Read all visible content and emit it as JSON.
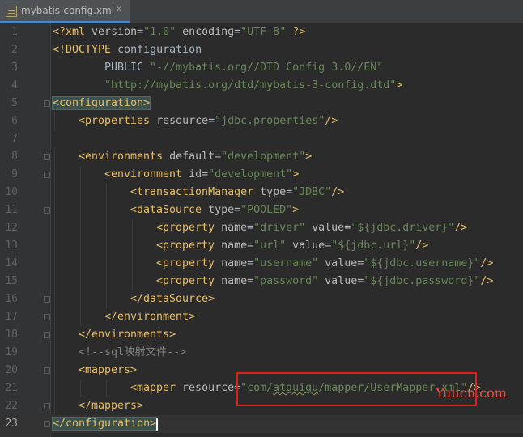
{
  "tab": {
    "filename": "mybatis-config.xml",
    "close_glyph": "✕",
    "icon": "xml-file-icon"
  },
  "lines": [
    {
      "n": "1",
      "indent": 0,
      "fold": false,
      "segs": [
        [
          "t-dec",
          "<?xml "
        ],
        [
          "t-attr",
          "version"
        ],
        [
          "t-txt",
          "="
        ],
        [
          "t-val",
          "\"1.0\""
        ],
        [
          "t-attr",
          " encoding"
        ],
        [
          "t-txt",
          "="
        ],
        [
          "t-val",
          "\"UTF-8\""
        ],
        [
          "t-dec",
          " ?>"
        ]
      ]
    },
    {
      "n": "2",
      "indent": 0,
      "fold": false,
      "segs": [
        [
          "t-tag",
          "<!DOCTYPE "
        ],
        [
          "t-txt",
          "configuration"
        ]
      ]
    },
    {
      "n": "3",
      "indent": 2,
      "fold": false,
      "segs": [
        [
          "t-txt",
          "PUBLIC "
        ],
        [
          "t-val",
          "\"-//mybatis.org//DTD Config 3.0//EN\""
        ]
      ]
    },
    {
      "n": "4",
      "indent": 2,
      "fold": false,
      "segs": [
        [
          "t-val",
          "\"http://mybatis.org/dtd/mybatis-3-config.dtd\""
        ],
        [
          "t-tag",
          ">"
        ]
      ]
    },
    {
      "n": "5",
      "indent": 0,
      "fold": true,
      "segs": [
        [
          "t-tag hl",
          "<configuration>"
        ]
      ]
    },
    {
      "n": "6",
      "indent": 1,
      "fold": false,
      "segs": [
        [
          "t-tag",
          "<properties "
        ],
        [
          "t-attr",
          "resource"
        ],
        [
          "t-txt",
          "="
        ],
        [
          "t-val",
          "\"jdbc.properties\""
        ],
        [
          "t-tag",
          "/>"
        ]
      ]
    },
    {
      "n": "7",
      "indent": 0,
      "fold": false,
      "segs": []
    },
    {
      "n": "8",
      "indent": 1,
      "fold": true,
      "segs": [
        [
          "t-tag",
          "<environments "
        ],
        [
          "t-attr",
          "default"
        ],
        [
          "t-txt",
          "="
        ],
        [
          "t-val",
          "\"development\""
        ],
        [
          "t-tag",
          ">"
        ]
      ]
    },
    {
      "n": "9",
      "indent": 2,
      "fold": true,
      "segs": [
        [
          "t-tag",
          "<environment "
        ],
        [
          "t-attr",
          "id"
        ],
        [
          "t-txt",
          "="
        ],
        [
          "t-val",
          "\"development\""
        ],
        [
          "t-tag",
          ">"
        ]
      ]
    },
    {
      "n": "10",
      "indent": 3,
      "fold": false,
      "segs": [
        [
          "t-tag",
          "<transactionManager "
        ],
        [
          "t-attr",
          "type"
        ],
        [
          "t-txt",
          "="
        ],
        [
          "t-val",
          "\"JDBC\""
        ],
        [
          "t-tag",
          "/>"
        ]
      ]
    },
    {
      "n": "11",
      "indent": 3,
      "fold": true,
      "segs": [
        [
          "t-tag",
          "<dataSource "
        ],
        [
          "t-attr",
          "type"
        ],
        [
          "t-txt",
          "="
        ],
        [
          "t-val",
          "\"POOLED\""
        ],
        [
          "t-tag",
          ">"
        ]
      ]
    },
    {
      "n": "12",
      "indent": 4,
      "fold": false,
      "segs": [
        [
          "t-tag",
          "<property "
        ],
        [
          "t-attr",
          "name"
        ],
        [
          "t-txt",
          "="
        ],
        [
          "t-val",
          "\"driver\""
        ],
        [
          "t-attr",
          " value"
        ],
        [
          "t-txt",
          "="
        ],
        [
          "t-val",
          "\"${jdbc.driver}\""
        ],
        [
          "t-tag",
          "/>"
        ]
      ]
    },
    {
      "n": "13",
      "indent": 4,
      "fold": false,
      "segs": [
        [
          "t-tag",
          "<property "
        ],
        [
          "t-attr",
          "name"
        ],
        [
          "t-txt",
          "="
        ],
        [
          "t-val",
          "\"url\""
        ],
        [
          "t-attr",
          " value"
        ],
        [
          "t-txt",
          "="
        ],
        [
          "t-val",
          "\"${jdbc.url}\""
        ],
        [
          "t-tag",
          "/>"
        ]
      ]
    },
    {
      "n": "14",
      "indent": 4,
      "fold": false,
      "segs": [
        [
          "t-tag",
          "<property "
        ],
        [
          "t-attr",
          "name"
        ],
        [
          "t-txt",
          "="
        ],
        [
          "t-val",
          "\"username\""
        ],
        [
          "t-attr",
          " value"
        ],
        [
          "t-txt",
          "="
        ],
        [
          "t-val",
          "\"${jdbc.username}\""
        ],
        [
          "t-tag",
          "/>"
        ]
      ]
    },
    {
      "n": "15",
      "indent": 4,
      "fold": false,
      "segs": [
        [
          "t-tag",
          "<property "
        ],
        [
          "t-attr",
          "name"
        ],
        [
          "t-txt",
          "="
        ],
        [
          "t-val",
          "\"password\""
        ],
        [
          "t-attr",
          " value"
        ],
        [
          "t-txt",
          "="
        ],
        [
          "t-val",
          "\"${jdbc.password}\""
        ],
        [
          "t-tag",
          "/>"
        ]
      ]
    },
    {
      "n": "16",
      "indent": 3,
      "fold": true,
      "segs": [
        [
          "t-tag",
          "</dataSource>"
        ]
      ]
    },
    {
      "n": "17",
      "indent": 2,
      "fold": true,
      "segs": [
        [
          "t-tag",
          "</environment>"
        ]
      ]
    },
    {
      "n": "18",
      "indent": 1,
      "fold": true,
      "segs": [
        [
          "t-tag",
          "</environments>"
        ]
      ]
    },
    {
      "n": "19",
      "indent": 1,
      "fold": false,
      "segs": [
        [
          "t-cmt",
          "<!--sql映射文件-->"
        ]
      ]
    },
    {
      "n": "20",
      "indent": 1,
      "fold": true,
      "segs": [
        [
          "t-tag",
          "<mappers>"
        ]
      ]
    },
    {
      "n": "21",
      "indent": 3,
      "fold": false,
      "segs": [
        [
          "t-tag",
          "<mapper "
        ],
        [
          "t-attr",
          "resource"
        ],
        [
          "t-txt",
          "="
        ],
        [
          "t-val",
          "\"com/"
        ],
        [
          "t-val squiggle",
          "atguigu"
        ],
        [
          "t-val",
          "/mapper/UserMapper.xml\""
        ],
        [
          "t-tag",
          "/>"
        ]
      ]
    },
    {
      "n": "22",
      "indent": 1,
      "fold": true,
      "segs": [
        [
          "t-tag",
          "</mappers>"
        ]
      ]
    },
    {
      "n": "23",
      "indent": 0,
      "fold": true,
      "segs": [
        [
          "t-tag hl",
          "</configuration>"
        ]
      ]
    }
  ],
  "current_line": "23",
  "watermark": "Yuucn.com",
  "colors": {
    "background": "#2b2b2b",
    "tag": "#e8bf6a",
    "value": "#6a8759",
    "attribute": "#bababa",
    "highlight_box": "#e0201b"
  }
}
